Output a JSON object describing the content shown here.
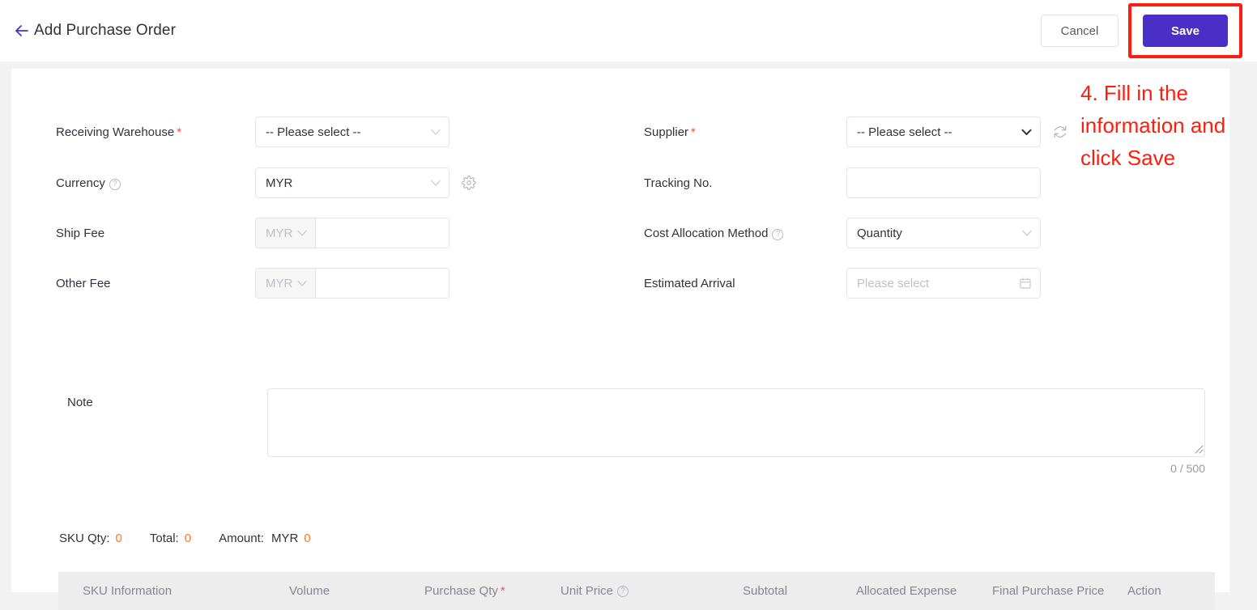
{
  "header": {
    "back_icon": "back-arrow-icon",
    "title": "Add Purchase Order",
    "cancel_label": "Cancel",
    "save_label": "Save"
  },
  "annotation": {
    "text": "4. Fill in the information and click Save",
    "color": "#fe1d0d"
  },
  "form": {
    "receiving_warehouse": {
      "label": "Receiving Warehouse",
      "required": "*",
      "value": "-- Please select --"
    },
    "currency": {
      "label": "Currency",
      "help_icon": "question-circle-icon",
      "value": "MYR",
      "settings_icon": "gear-icon"
    },
    "ship_fee": {
      "label": "Ship Fee",
      "currency": "MYR",
      "value": ""
    },
    "other_fee": {
      "label": "Other Fee",
      "currency": "MYR",
      "value": ""
    },
    "supplier": {
      "label": "Supplier",
      "required": "*",
      "value": "-- Please select --",
      "refresh_icon": "refresh-icon"
    },
    "tracking_no": {
      "label": "Tracking No.",
      "value": "",
      "placeholder": ""
    },
    "cost_allocation_method": {
      "label": "Cost Allocation Method",
      "help_icon": "question-circle-icon",
      "value": "Quantity"
    },
    "estimated_arrival": {
      "label": "Estimated Arrival",
      "placeholder": "Please select",
      "calendar_icon": "calendar-icon"
    },
    "note": {
      "label": "Note",
      "value": "",
      "placeholder": "",
      "counter": "0 / 500"
    }
  },
  "totals": {
    "sku_qty_label": "SKU Qty:",
    "sku_qty_value": "0",
    "total_label": "Total:",
    "total_value": "0",
    "amount_label": "Amount:",
    "amount_currency": "MYR",
    "amount_value": "0",
    "accent_color": "#ff7a1a"
  },
  "table": {
    "columns": [
      {
        "label": "SKU Information",
        "required": ""
      },
      {
        "label": "Volume",
        "required": ""
      },
      {
        "label": "Purchase Qty",
        "required": "*"
      },
      {
        "label": "Unit Price",
        "help_icon": "question-circle-icon"
      },
      {
        "label": "Subtotal",
        "required": ""
      },
      {
        "label": "Allocated Expense",
        "required": ""
      },
      {
        "label": "Final Purchase Price",
        "required": ""
      },
      {
        "label": "Action",
        "required": ""
      }
    ],
    "rows": []
  }
}
